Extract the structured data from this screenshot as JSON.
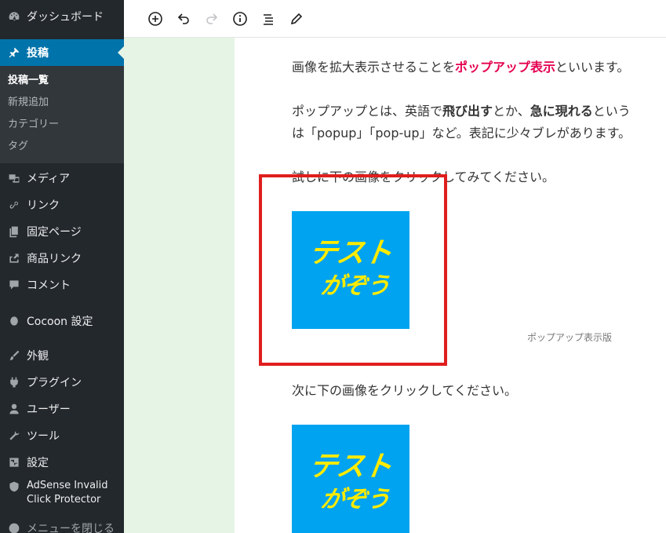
{
  "sidebar": {
    "dashboard": "ダッシュボード",
    "posts": "投稿",
    "posts_sub": [
      "投稿一覧",
      "新規追加",
      "カテゴリー",
      "タグ"
    ],
    "media": "メディア",
    "links": "リンク",
    "pages": "固定ページ",
    "product_links": "商品リンク",
    "comments": "コメント",
    "cocoon": "Cocoon 設定",
    "appearance": "外観",
    "plugins": "プラグイン",
    "users": "ユーザー",
    "tools": "ツール",
    "settings": "設定",
    "adsense_line1": "AdSense Invalid",
    "adsense_line2": "Click Protector",
    "collapse": "メニューを閉じる"
  },
  "content": {
    "p1_pre": "画像を拡大表示させることを",
    "p1_hl": "ポップアップ表示",
    "p1_post": "といいます。",
    "p2_a": "ポップアップとは、英語で",
    "p2_b": "飛び出す",
    "p2_c": "とか、",
    "p2_d": "急に現れる",
    "p2_e": "という",
    "p2_line2": "は「popup」「pop-up」など。表記に少々ブレがあります。",
    "p3": "試しに下の画像をクリックしてみてください。",
    "image1_line1": "テスト",
    "image1_line2": "がぞう",
    "caption": "ポップアップ表示版",
    "p4": "次に下の画像をクリックしてください。",
    "image2_line1": "テスト",
    "image2_line2": "がぞう"
  },
  "colors": {
    "sidebar_bg": "#23282d",
    "sidebar_active": "#0073aa",
    "highlight_red": "#e4004f",
    "image_bg": "#00a3ef",
    "image_text": "#ffeb00",
    "annotation_box": "#e01e1e"
  }
}
